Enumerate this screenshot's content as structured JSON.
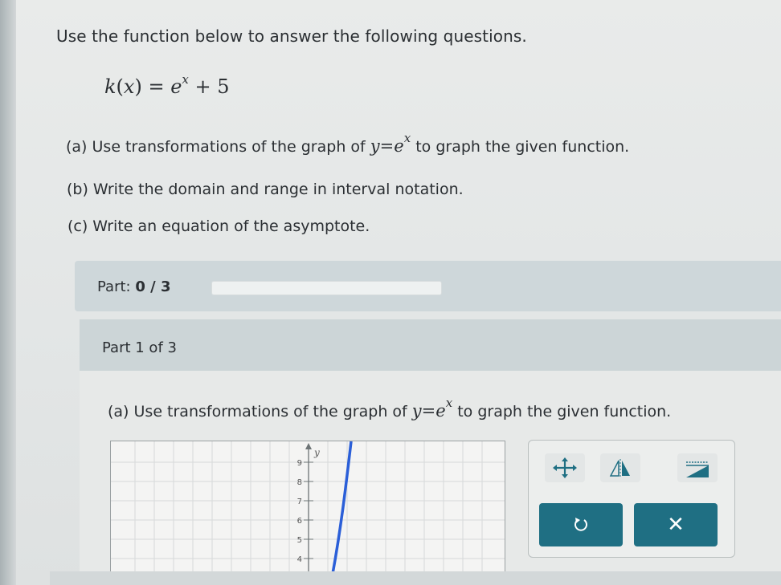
{
  "intro": "Use the function below to answer the following questions.",
  "formula": {
    "lhs": "k",
    "arg": "x",
    "base": "e",
    "exponent": "x",
    "plus": "+ 5"
  },
  "questions": {
    "a": {
      "prefix": "(a) Use transformations of the graph of",
      "math_y": "y",
      "math_eq": "=",
      "math_e": "e",
      "math_exp": "x",
      "suffix": "to graph the given function."
    },
    "b": "(b) Write the domain and range in interval notation.",
    "c": "(c) Write an equation of the asymptote."
  },
  "part_progress": {
    "label": "Part:",
    "value": "0 / 3",
    "fraction": 0.0
  },
  "part_heading": "Part 1 of 3",
  "sub_question": {
    "prefix": "(a) Use transformations of the graph of",
    "math_y": "y",
    "math_eq": "=",
    "math_e": "e",
    "math_exp": "x",
    "suffix": "to graph the given function."
  },
  "graph": {
    "y_axis_label": "y",
    "y_ticks": [
      "9",
      "8",
      "7",
      "6",
      "5",
      "4"
    ],
    "curve_color": "#2b5fd8"
  },
  "tools": {
    "move_icon": "move-arrows-icon",
    "reflect_icon": "reflect-triangles-icon",
    "stretch_icon": "stretch-icon",
    "undo_icon": "undo-icon",
    "clear_icon": "close-icon",
    "clear_label": "✕"
  },
  "colors": {
    "accent": "#1f6f83",
    "progress_track": "#eef1f1"
  }
}
